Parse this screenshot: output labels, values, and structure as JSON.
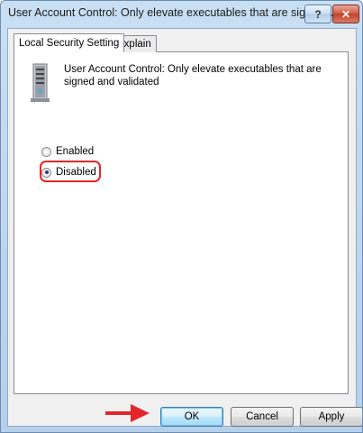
{
  "window": {
    "title": "User Account Control: Only elevate executables that are signed ...",
    "help_label": "?",
    "close_label": "✕"
  },
  "tabs": [
    {
      "label": "Local Security Setting",
      "selected": true
    },
    {
      "label": "Explain",
      "selected": false
    }
  ],
  "policy": {
    "description": "User Account Control: Only elevate executables that are signed and validated",
    "icon": "server-policy-icon"
  },
  "options": [
    {
      "label": "Enabled",
      "checked": false
    },
    {
      "label": "Disabled",
      "checked": true
    }
  ],
  "buttons": {
    "ok": "OK",
    "cancel": "Cancel",
    "apply": "Apply"
  },
  "annotations": {
    "highlight_color": "#e2262a",
    "arrow_color": "#e2262a"
  }
}
